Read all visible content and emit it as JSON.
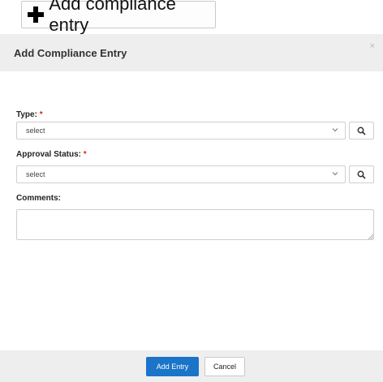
{
  "launcher": {
    "label": "Add compliance entry",
    "icon": "plus-icon"
  },
  "modal": {
    "title": "Add Compliance Entry",
    "close_icon": "close-icon",
    "close_glyph": "×"
  },
  "form": {
    "type": {
      "label": "Type:",
      "required_marker": "*",
      "selected": "select",
      "search_icon": "search-icon"
    },
    "approval_status": {
      "label": "Approval Status:",
      "required_marker": "*",
      "selected": "select",
      "search_icon": "search-icon"
    },
    "comments": {
      "label": "Comments:",
      "value": ""
    }
  },
  "footer": {
    "submit_label": "Add Entry",
    "cancel_label": "Cancel"
  },
  "colors": {
    "primary": "#1a74c8",
    "required": "#d9261c",
    "header_bg": "#eeeeee"
  }
}
